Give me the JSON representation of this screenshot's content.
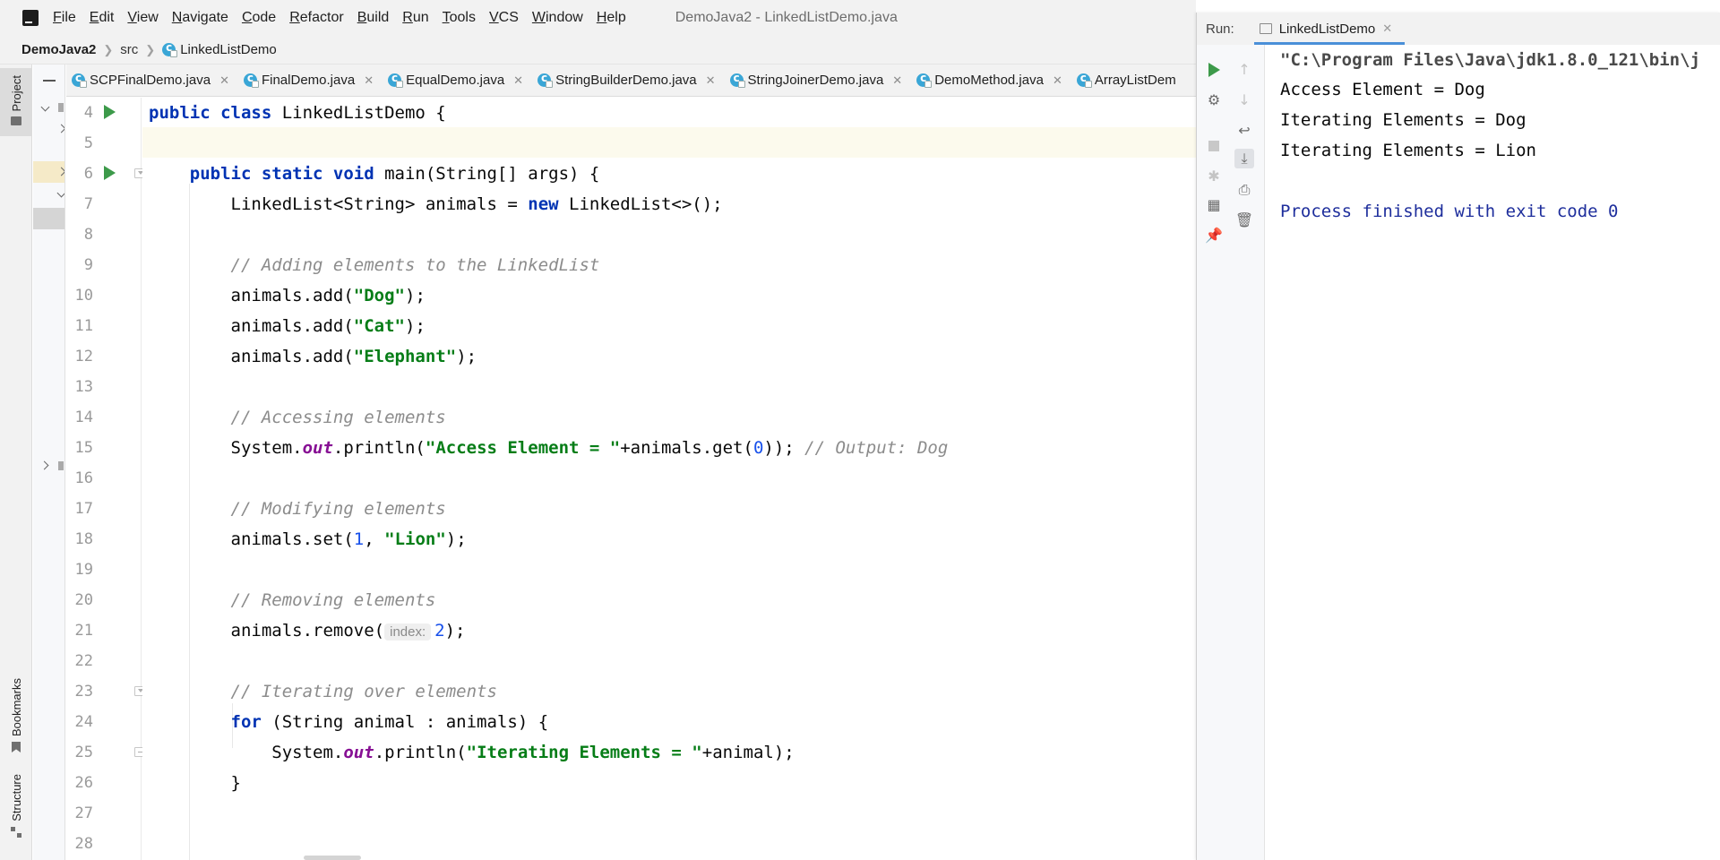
{
  "menubar": {
    "items": [
      {
        "mnemonic": "F",
        "rest": "ile"
      },
      {
        "mnemonic": "E",
        "rest": "dit"
      },
      {
        "mnemonic": "V",
        "rest": "iew"
      },
      {
        "mnemonic": "N",
        "rest": "avigate"
      },
      {
        "mnemonic": "C",
        "rest": "ode"
      },
      {
        "mnemonic": "R",
        "rest": "efactor"
      },
      {
        "mnemonic": "B",
        "rest": "uild"
      },
      {
        "mnemonic": "R",
        "rest": "un"
      },
      {
        "mnemonic": "T",
        "rest": "ools"
      },
      {
        "mnemonic": "V",
        "rest": "CS"
      },
      {
        "mnemonic": "W",
        "rest": "indow"
      },
      {
        "mnemonic": "H",
        "rest": "elp"
      }
    ],
    "window_title": "DemoJava2 - LinkedListDemo.java"
  },
  "breadcrumb": {
    "project": "DemoJava2",
    "folder": "src",
    "file": "LinkedListDemo"
  },
  "side_panels": {
    "project": "Project",
    "bookmarks": "Bookmarks",
    "structure": "Structure"
  },
  "editor_tabs": [
    {
      "label": "SCPFinalDemo.java"
    },
    {
      "label": "FinalDemo.java"
    },
    {
      "label": "EqualDemo.java"
    },
    {
      "label": "StringBuilderDemo.java"
    },
    {
      "label": "StringJoinerDemo.java"
    },
    {
      "label": "DemoMethod.java"
    },
    {
      "label": "ArrayListDem"
    }
  ],
  "editor": {
    "line_numbers": [
      "4",
      "5",
      "6",
      "7",
      "8",
      "9",
      "10",
      "11",
      "12",
      "13",
      "14",
      "15",
      "16",
      "17",
      "18",
      "19",
      "20",
      "21",
      "22",
      "23",
      "24",
      "25",
      "26",
      "27",
      "28"
    ],
    "code": {
      "l4": {
        "kw": "public class",
        "rest": " LinkedListDemo {"
      },
      "l6": {
        "kw": "public static void",
        "rest": " main(String[] args) {"
      },
      "l7": {
        "a": "LinkedList<String> animals = ",
        "kw": "new",
        "b": " LinkedList<>();"
      },
      "l9": {
        "comment": "// Adding elements to the LinkedList"
      },
      "l10": {
        "a": "animals.add(",
        "str": "\"Dog\"",
        "b": ");"
      },
      "l11": {
        "a": "animals.add(",
        "str": "\"Cat\"",
        "b": ");"
      },
      "l12": {
        "a": "animals.add(",
        "str": "\"Elephant\"",
        "b": ");"
      },
      "l14": {
        "comment": "// Accessing elements"
      },
      "l15": {
        "a": "System.",
        "field": "out",
        "b": ".println(",
        "str": "\"Access Element = \"",
        "c": "+animals.get(",
        "num": "0",
        "d": ")); ",
        "comment": "// Output: Dog"
      },
      "l17": {
        "comment": "// Modifying elements"
      },
      "l18": {
        "a": "animals.set(",
        "num": "1",
        "b": ", ",
        "str": "\"Lion\"",
        "c": ");"
      },
      "l20": {
        "comment": "// Removing elements"
      },
      "l21": {
        "a": "animals.remove(",
        "hint": "index:",
        "num": "2",
        "b": ");"
      },
      "l23": {
        "comment": "// Iterating over elements"
      },
      "l24": {
        "kw": "for",
        "rest": " (String animal : animals) {"
      },
      "l25": {
        "a": "System.",
        "field": "out",
        "b": ".println(",
        "str": "\"Iterating Elements = \"",
        "c": "+animal);"
      },
      "l26": {
        "rest": "}"
      }
    }
  },
  "run_window": {
    "title": "Run:",
    "tab_label": "LinkedListDemo",
    "console": [
      "\"C:\\Program Files\\Java\\jdk1.8.0_121\\bin\\j",
      "Access Element = Dog",
      "Iterating Elements = Dog",
      "Iterating Elements = Lion",
      "",
      "Process finished with exit code 0"
    ]
  },
  "colors": {
    "keyword": "#0033b3",
    "string": "#067d17",
    "comment": "#8c8c8c",
    "number": "#1750eb",
    "field": "#871094",
    "run_green": "#3d9a4a",
    "exit_text": "#1e2e9c"
  }
}
